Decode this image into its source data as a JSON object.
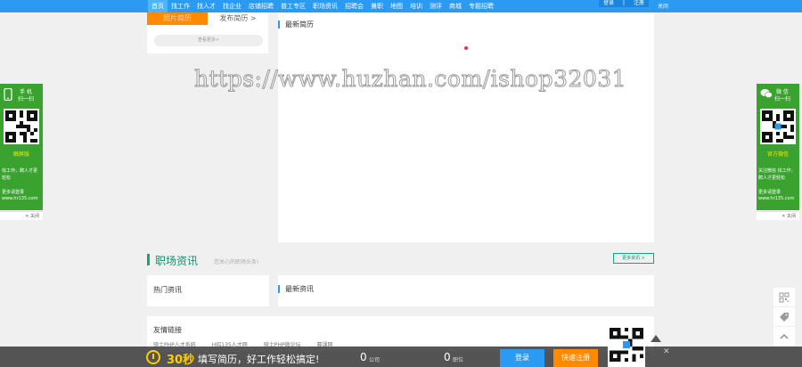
{
  "nav": {
    "items": [
      "首页",
      "找工作",
      "找人才",
      "找企业",
      "店铺招聘",
      "普工专区",
      "职场资讯",
      "招聘会",
      "兼职",
      "地图",
      "培训",
      "测评",
      "商城",
      "专题招聘"
    ],
    "login": "登录",
    "separator": "|",
    "register": "注册",
    "close": "关闭"
  },
  "left_card": {
    "tab_photo": "照片简历",
    "tab_publish": "发布简历 >",
    "more": "查看更多>"
  },
  "latest_resumes": {
    "title": "最新简历"
  },
  "watermark": "https://www.huzhan.com/ishop32031",
  "left_float": {
    "line1": "手  机",
    "line2": "扫一扫",
    "tag": "触屏版",
    "text1": "找工作，聘人才更轻松",
    "text2": "更多请登录",
    "text3": "www.hr135.com",
    "close": "✕ 关闭"
  },
  "right_float": {
    "line1": "微  信",
    "line2": "扫一扫",
    "tag": "官方微信",
    "text1": "关注微信 找工作，聘人才更轻松",
    "text2": "更多请登录",
    "text3": "www.hr135.com",
    "close": "✕ 关闭"
  },
  "career_news": {
    "title": "职场资讯",
    "subtitle": "您关心的职场头条!",
    "more": "更多资讯 >",
    "hot": "热门资讯",
    "latest": "最新资讯"
  },
  "links": {
    "title": "友情链接",
    "items": [
      "骑士PHP人才系统",
      "H招135人才网",
      "骑士PHP微论坛",
      "赛课网"
    ]
  },
  "bottom_bar": {
    "seconds": "30秒",
    "slogan": "填写简历，好工作轻松搞定!",
    "company_count": "0",
    "company_unit": "公司",
    "job_count": "0",
    "job_unit": "职位",
    "login": "登录",
    "register": "快速注册",
    "close": "✕"
  },
  "icons": {
    "phone": "phone-icon",
    "wechat": "wechat-icon",
    "qrcode": "qrcode-icon",
    "tag": "tag-icon",
    "top": "chevron-up-icon",
    "clock": "clock-icon"
  },
  "colors": {
    "nav_blue": "#2a9af3",
    "accent_orange": "#ff8a00",
    "float_green": "#3aa32f",
    "news_green": "#1aa37a"
  }
}
